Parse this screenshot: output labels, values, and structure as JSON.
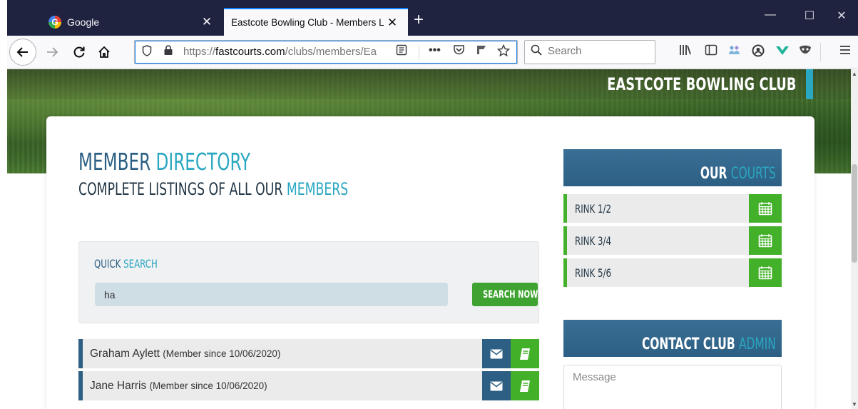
{
  "browser": {
    "tabs": [
      {
        "label": "Google",
        "close": "✕"
      },
      {
        "label": "Eastcote Bowling Club - Members L",
        "close": "✕"
      }
    ],
    "new_tab": "+",
    "window_controls": {
      "minimize": "—",
      "maximize": "☐",
      "close": "✕"
    },
    "url_prefix": "https://",
    "url_domain": "fastcourts.com",
    "url_path": "/clubs/members/Ea",
    "search_placeholder": "Search",
    "accent_color": "#0a84ff"
  },
  "site": {
    "club_name": "EASTCOTE BOWLING CLUB",
    "brand_dark": "#2c5f83",
    "brand_accent": "#2aa7c1",
    "brand_green": "#43b02a"
  },
  "directory": {
    "title_main": "MEMBER ",
    "title_accent": "DIRECTORY",
    "subtitle_main": "COMPLETE LISTINGS OF ALL OUR ",
    "subtitle_accent": "MEMBERS"
  },
  "quick_search": {
    "title_main": "QUICK ",
    "title_accent": "SEARCH",
    "value": "ha",
    "button": "SEARCH NOW"
  },
  "members": [
    {
      "name": "Graham Aylett",
      "since": "(Member since 10/06/2020)"
    },
    {
      "name": "Jane Harris",
      "since": "(Member since 10/06/2020)"
    }
  ],
  "courts": {
    "title_main": "OUR ",
    "title_accent": "COURTS",
    "items": [
      {
        "label": "RINK 1/2"
      },
      {
        "label": "RINK 3/4"
      },
      {
        "label": "RINK 5/6"
      }
    ]
  },
  "contact": {
    "title_main": "CONTACT CLUB ",
    "title_accent": "ADMIN",
    "message_placeholder": "Message"
  }
}
